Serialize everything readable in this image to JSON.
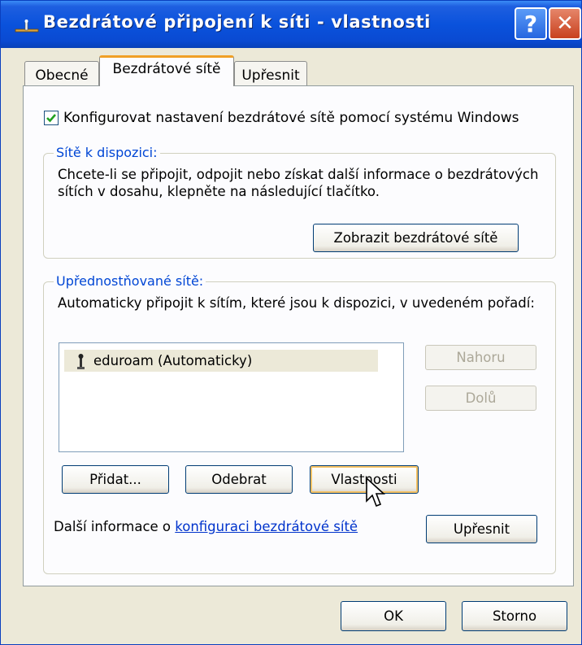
{
  "window": {
    "title": "Bezdrátové připojení k síti - vlastnosti",
    "help_label": "?",
    "close_label": "✕"
  },
  "tabs": [
    {
      "label": "Obecné"
    },
    {
      "label": "Bezdrátové sítě"
    },
    {
      "label": "Upřesnit"
    }
  ],
  "configure_checkbox": {
    "label": "Konfigurovat nastavení bezdrátové sítě pomocí systému Windows",
    "checked": true
  },
  "available": {
    "title": "Sítě k dispozici:",
    "description": "Chcete-li se připojit, odpojit nebo získat další informace o bezdrátových sítích v dosahu, klepněte na následující tlačítko.",
    "show_button": "Zobrazit bezdrátové sítě"
  },
  "preferred": {
    "title": "Upřednostňované sítě:",
    "description": "Automaticky připojit k sítím, které jsou k dispozici, v uvedeném pořadí:",
    "networks": [
      "eduroam (Automaticky)"
    ],
    "up_button": "Nahoru",
    "down_button": "Dolů",
    "add_button": "Přidat...",
    "remove_button": "Odebrat",
    "properties_button": "Vlastnosti",
    "info_prefix": "Další informace o ",
    "info_link": "konfiguraci bezdrátové sítě",
    "advanced_button": "Upřesnit"
  },
  "footer": {
    "ok_button": "OK",
    "cancel_button": "Storno"
  },
  "colors": {
    "titlebar": "#0a52dc",
    "group_title": "#0046d5",
    "link": "#0033cc"
  }
}
